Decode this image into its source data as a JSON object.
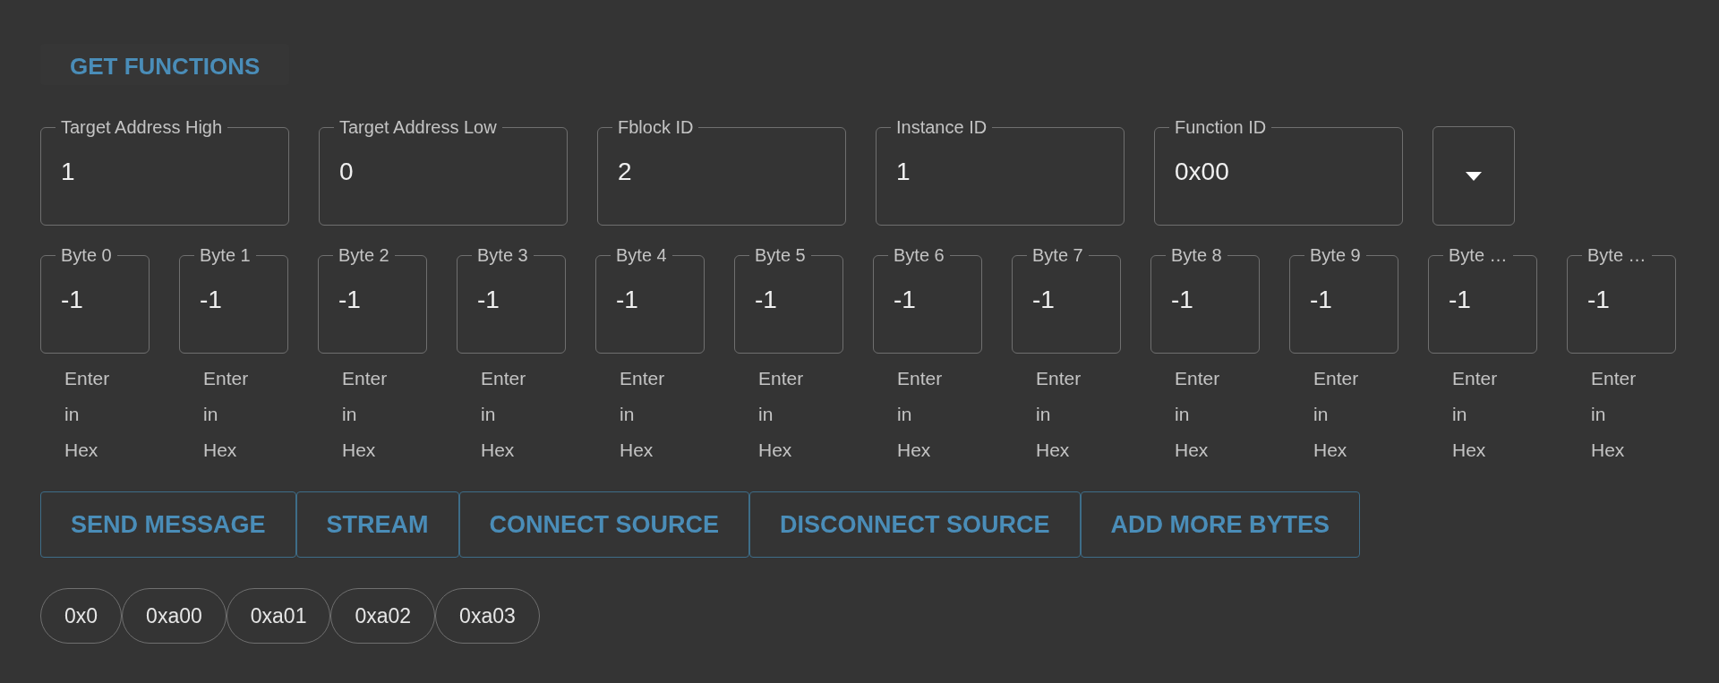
{
  "get_functions_button": "GET FUNCTIONS",
  "address_fields": [
    {
      "label": "Target Address High",
      "value": "1"
    },
    {
      "label": "Target Address Low",
      "value": "0"
    },
    {
      "label": "Fblock ID",
      "value": "2"
    },
    {
      "label": "Instance ID",
      "value": "1"
    },
    {
      "label": "Function ID",
      "value": "0x00"
    }
  ],
  "byte_fields": [
    {
      "label": "Byte 0",
      "value": "-1",
      "helper": "Enter in Hex"
    },
    {
      "label": "Byte 1",
      "value": "-1",
      "helper": "Enter in Hex"
    },
    {
      "label": "Byte 2",
      "value": "-1",
      "helper": "Enter in Hex"
    },
    {
      "label": "Byte 3",
      "value": "-1",
      "helper": "Enter in Hex"
    },
    {
      "label": "Byte 4",
      "value": "-1",
      "helper": "Enter in Hex"
    },
    {
      "label": "Byte 5",
      "value": "-1",
      "helper": "Enter in Hex"
    },
    {
      "label": "Byte 6",
      "value": "-1",
      "helper": "Enter in Hex"
    },
    {
      "label": "Byte 7",
      "value": "-1",
      "helper": "Enter in Hex"
    },
    {
      "label": "Byte 8",
      "value": "-1",
      "helper": "Enter in Hex"
    },
    {
      "label": "Byte 9",
      "value": "-1",
      "helper": "Enter in Hex"
    },
    {
      "label": "Byte …",
      "value": "-1",
      "helper": "Enter in Hex"
    },
    {
      "label": "Byte …",
      "value": "-1",
      "helper": "Enter in Hex"
    }
  ],
  "action_buttons": [
    "SEND MESSAGE",
    "STREAM",
    "CONNECT SOURCE",
    "DISCONNECT SOURCE",
    "ADD MORE BYTES"
  ],
  "chips": [
    "0x0",
    "0xa00",
    "0xa01",
    "0xa02",
    "0xa03"
  ]
}
